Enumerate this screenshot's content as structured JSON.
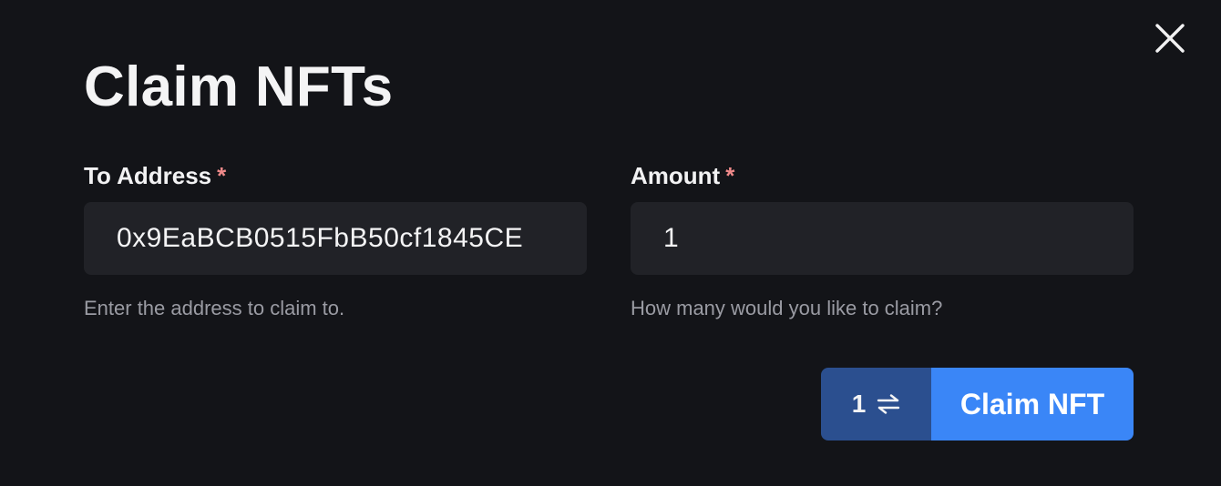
{
  "modal": {
    "title": "Claim NFTs"
  },
  "to_address": {
    "label": "To Address",
    "required_mark": "*",
    "value": "0x9EaBCB0515FbB50cf1845CE",
    "helper": "Enter the address to claim to."
  },
  "amount": {
    "label": "Amount",
    "required_mark": "*",
    "value": "1",
    "helper": "How many would you like to claim?"
  },
  "action": {
    "quantity": "1",
    "quantity_icon": "swap-arrows-icon",
    "claim_label": "Claim NFT"
  },
  "colors": {
    "background": "#131418",
    "input_bg": "#212227",
    "required": "#f08a8a",
    "quantity_bg": "#2b4f8f",
    "primary": "#3a86f7"
  }
}
